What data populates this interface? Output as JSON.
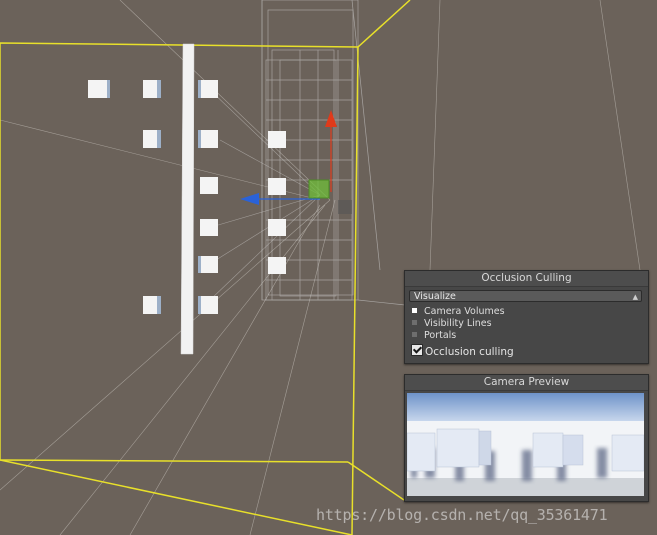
{
  "occlusion_panel": {
    "title": "Occlusion Culling",
    "dropdown_value": "Visualize",
    "legend": [
      {
        "label": "Camera Volumes",
        "color": "#ffffff"
      },
      {
        "label": "Visibility Lines",
        "color": "#6e6e6e"
      },
      {
        "label": "Portals",
        "color": "#6e6e6e"
      }
    ],
    "checkbox_label": "Occlusion culling",
    "checkbox_checked": true
  },
  "camera_preview": {
    "title": "Camera Preview"
  },
  "watermark": "https://blog.csdn.net/qq_35361471",
  "colors": {
    "scene_background": "#6b625a",
    "volume_outline": "#e8e02a",
    "gizmo_y": "#e03a1a",
    "gizmo_z": "#2a62d8",
    "gizmo_center": "#6fbf3a"
  }
}
